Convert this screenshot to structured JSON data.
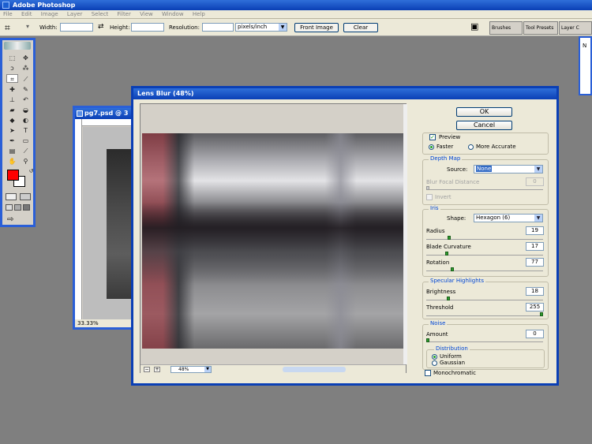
{
  "app": {
    "title": "Adobe Photoshop"
  },
  "menu": [
    "File",
    "Edit",
    "Image",
    "Layer",
    "Select",
    "Filter",
    "View",
    "Window",
    "Help"
  ],
  "options": {
    "width_label": "Width:",
    "height_label": "Height:",
    "resolution_label": "Resolution:",
    "units": "pixels/inch",
    "front_image": "Front Image",
    "clear": "Clear",
    "palettes": [
      "Brushes",
      "Tool Presets",
      "Layer C"
    ]
  },
  "right_palette": {
    "text": "N"
  },
  "document": {
    "title": "pg7.psd @ 3",
    "zoom": "33.33%"
  },
  "dialog": {
    "title": "Lens Blur (48%)",
    "ok": "OK",
    "cancel": "Cancel",
    "preview": {
      "label": "Preview",
      "checked": true,
      "faster": "Faster",
      "more_accurate": "More Accurate",
      "selected": "Faster"
    },
    "depth_map": {
      "title": "Depth Map",
      "source_label": "Source:",
      "source_value": "None",
      "blur_focal_label": "Blur Focal Distance",
      "blur_focal_value": "0",
      "invert_label": "Invert"
    },
    "iris": {
      "title": "Iris",
      "shape_label": "Shape:",
      "shape_value": "Hexagon (6)",
      "radius_label": "Radius",
      "radius_value": "19",
      "radius_max": 100,
      "blade_label": "Blade Curvature",
      "blade_value": "17",
      "blade_max": 100,
      "rotation_label": "Rotation",
      "rotation_value": "77",
      "rotation_max": 360
    },
    "specular": {
      "title": "Specular Highlights",
      "brightness_label": "Brightness",
      "brightness_value": "18",
      "brightness_max": 100,
      "threshold_label": "Threshold",
      "threshold_value": "255",
      "threshold_max": 255
    },
    "noise": {
      "title": "Noise",
      "amount_label": "Amount",
      "amount_value": "0",
      "distribution_title": "Distribution",
      "uniform": "Uniform",
      "gaussian": "Gaussian",
      "selected": "Uniform",
      "monochromatic": "Monochromatic"
    },
    "zoom": "48%"
  },
  "colors": {
    "titlebar": "#0a3fb5",
    "foreground": "#ff0000",
    "accent": "#21a121"
  }
}
